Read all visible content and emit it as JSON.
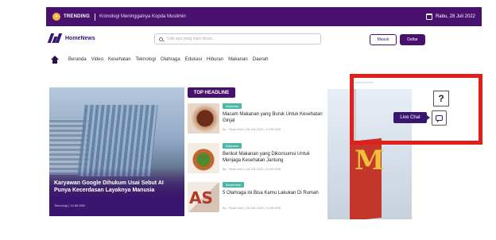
{
  "topbar": {
    "trending_label": "TRENDING",
    "trending_text": "Kronologi Meninggalnya Kopda Muslimin",
    "date": "Rabu, 28 Juli 2022"
  },
  "header": {
    "logo_text": "HomeNews",
    "search_placeholder": "Tulis apa yang ingin dicari...",
    "login_label": "Masuk",
    "register_label": "Daftar"
  },
  "nav": {
    "items": [
      "Beranda",
      "Video",
      "Kesehatan",
      "Teknologi",
      "Olahraga",
      "Edukasi",
      "Hiburan",
      "Makanan",
      "Daerah"
    ]
  },
  "hero": {
    "title": "Karyawan Google Dihukum Usai Sebut AI Punya Kecerdasan Layaknya Manusia",
    "meta": "Teknologi | 14:58 WIB"
  },
  "top_headline": {
    "label": "TOP HEADLINE",
    "items": [
      {
        "tag": "Makanan",
        "title": "Macam Makanan yang Buruk Untuk Kesehatan Ginjal",
        "meta": "By : Ryan Kahl | 28 Juli 2022 | 14:58 WIB"
      },
      {
        "tag": "Makanan",
        "title": "Berikut Makanan yang Dikonsumsi Untuk Menjaga Kesehatan Jantung",
        "meta": "By : Ryan Kahl | 28 Juli 2022 | 14:58 WIB"
      },
      {
        "tag": "Kesehatan",
        "title": "5 Olahraga ini Bisa Kamu Lakukan Di Rumah",
        "meta": "By : Ryan Kahl | 28 Juli 2022 | 14:58 WIB"
      }
    ]
  },
  "ad": {
    "label": "Advertisement"
  },
  "widgets": {
    "help_symbol": "?",
    "live_chat_label": "Live Chat"
  },
  "colors": {
    "brand_purple": "#48116e",
    "tag_teal": "#4bb7a6",
    "highlight_red": "#e1201b"
  }
}
